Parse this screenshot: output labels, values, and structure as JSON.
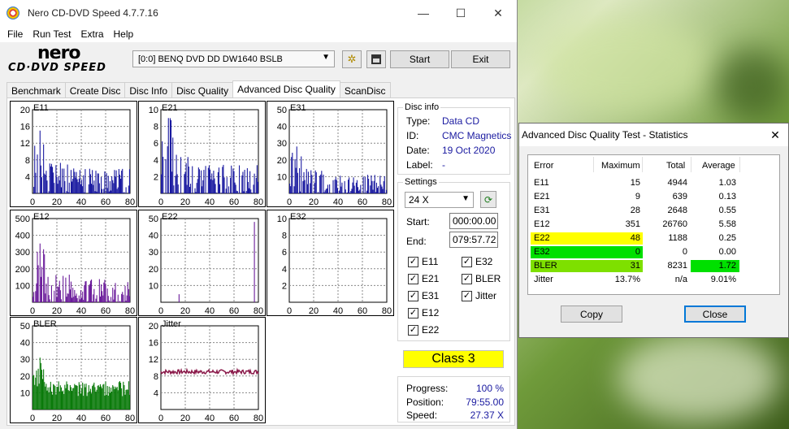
{
  "main_window": {
    "title": "Nero CD-DVD Speed 4.7.7.16",
    "controls": {
      "minimize": "—",
      "maximize": "☐",
      "close": "✕"
    },
    "menu": [
      "File",
      "Run Test",
      "Extra",
      "Help"
    ],
    "logo": {
      "top": "nero",
      "bottom": "CD·DVD SPEED"
    },
    "drive": "[0:0]   BENQ DVD DD DW1640 BSLB",
    "start_label": "Start",
    "exit_label": "Exit",
    "tabs": [
      "Benchmark",
      "Create Disc",
      "Disc Info",
      "Disc Quality",
      "Advanced Disc Quality",
      "ScanDisc"
    ],
    "active_tab": "Advanced Disc Quality"
  },
  "chart_data": [
    {
      "type": "bar",
      "title": "E11",
      "x_ticks": [
        "0",
        "20",
        "40",
        "60",
        "80"
      ],
      "y_ticks": [
        "20",
        "16",
        "12",
        "8",
        "4"
      ],
      "ylim": [
        0,
        20
      ],
      "color": "#1a1aa0",
      "max_value": 15,
      "seed": 11
    },
    {
      "type": "bar",
      "title": "E21",
      "x_ticks": [
        "0",
        "20",
        "40",
        "60",
        "80"
      ],
      "y_ticks": [
        "10",
        "8",
        "6",
        "4",
        "2"
      ],
      "ylim": [
        0,
        10
      ],
      "color": "#1a1aa0",
      "max_value": 9,
      "seed": 21
    },
    {
      "type": "bar",
      "title": "E31",
      "x_ticks": [
        "0",
        "20",
        "40",
        "60",
        "80"
      ],
      "y_ticks": [
        "50",
        "40",
        "30",
        "20",
        "10"
      ],
      "ylim": [
        0,
        50
      ],
      "color": "#1a1aa0",
      "max_value": 28,
      "seed": 31
    },
    {
      "type": "bar",
      "title": "E12",
      "x_ticks": [
        "0",
        "20",
        "40",
        "60",
        "80"
      ],
      "y_ticks": [
        "500",
        "400",
        "300",
        "200",
        "100"
      ],
      "ylim": [
        0,
        500
      ],
      "color": "#6a1a9a",
      "max_value": 351,
      "seed": 12
    },
    {
      "type": "bar",
      "title": "E22",
      "x_ticks": [
        "0",
        "20",
        "40",
        "60",
        "80"
      ],
      "y_ticks": [
        "50",
        "40",
        "30",
        "20",
        "10"
      ],
      "ylim": [
        0,
        50
      ],
      "color": "#6a1a9a",
      "max_value": 48,
      "seed": 22
    },
    {
      "type": "bar",
      "title": "E32",
      "x_ticks": [
        "0",
        "20",
        "40",
        "60",
        "80"
      ],
      "y_ticks": [
        "10",
        "8",
        "6",
        "4",
        "2"
      ],
      "ylim": [
        0,
        10
      ],
      "color": "#6a1a9a",
      "max_value": 0,
      "seed": 32
    },
    {
      "type": "bar",
      "title": "BLER",
      "x_ticks": [
        "0",
        "20",
        "40",
        "60",
        "80"
      ],
      "y_ticks": [
        "50",
        "40",
        "30",
        "20",
        "10"
      ],
      "ylim": [
        0,
        50
      ],
      "color": "#0a7a0a",
      "max_value": 31,
      "seed": 5
    },
    {
      "type": "line",
      "title": "Jitter",
      "x_ticks": [
        "0",
        "20",
        "40",
        "60",
        "80"
      ],
      "y_ticks": [
        "20",
        "16",
        "12",
        "8",
        "4"
      ],
      "ylim": [
        0,
        20
      ],
      "color": "#8a1a4a",
      "level": 9.01
    }
  ],
  "disc_info": {
    "title": "Disc info",
    "rows": [
      {
        "label": "Type:",
        "value": "Data CD"
      },
      {
        "label": "ID:",
        "value": "CMC Magnetics"
      },
      {
        "label": "Date:",
        "value": "19 Oct 2020"
      },
      {
        "label": "Label:",
        "value": "-"
      }
    ]
  },
  "settings": {
    "title": "Settings",
    "speed": "24 X",
    "start_label": "Start:",
    "start_value": "000:00.00",
    "end_label": "End:",
    "end_value": "079:57.72",
    "checkboxes": [
      {
        "label": "E11",
        "checked": true
      },
      {
        "label": "E32",
        "checked": true
      },
      {
        "label": "E21",
        "checked": true
      },
      {
        "label": "BLER",
        "checked": true
      },
      {
        "label": "E31",
        "checked": true
      },
      {
        "label": "Jitter",
        "checked": true
      },
      {
        "label": "E12",
        "checked": true
      },
      {
        "label": "E22",
        "checked": true
      }
    ]
  },
  "class_label": "Class 3",
  "progress": {
    "rows": [
      {
        "label": "Progress:",
        "value": "100 %"
      },
      {
        "label": "Position:",
        "value": "79:55.00"
      },
      {
        "label": "Speed:",
        "value": "27.37 X"
      }
    ]
  },
  "stats_dialog": {
    "title": "Advanced Disc Quality Test - Statistics",
    "close_glyph": "✕",
    "headers": [
      "Error",
      "Maximum",
      "Total",
      "Average"
    ],
    "rows": [
      {
        "name": "E11",
        "max": "15",
        "total": "4944",
        "avg": "1.03",
        "hl_name": "",
        "hl_avg": ""
      },
      {
        "name": "E21",
        "max": "9",
        "total": "639",
        "avg": "0.13",
        "hl_name": "",
        "hl_avg": ""
      },
      {
        "name": "E31",
        "max": "28",
        "total": "2648",
        "avg": "0.55",
        "hl_name": "",
        "hl_avg": ""
      },
      {
        "name": "E12",
        "max": "351",
        "total": "26760",
        "avg": "5.58",
        "hl_name": "",
        "hl_avg": ""
      },
      {
        "name": "E22",
        "max": "48",
        "total": "1188",
        "avg": "0.25",
        "hl_name": "#ffff00",
        "hl_avg": ""
      },
      {
        "name": "E32",
        "max": "0",
        "total": "0",
        "avg": "0.00",
        "hl_name": "#00e000",
        "hl_avg": ""
      },
      {
        "name": "BLER",
        "max": "31",
        "total": "8231",
        "avg": "1.72",
        "hl_name": "#7ee000",
        "hl_avg": "#00e000"
      },
      {
        "name": "Jitter",
        "max": "13.7%",
        "total": "n/a",
        "avg": "9.01%",
        "hl_name": "",
        "hl_avg": ""
      }
    ],
    "copy_label": "Copy",
    "close_label": "Close"
  }
}
